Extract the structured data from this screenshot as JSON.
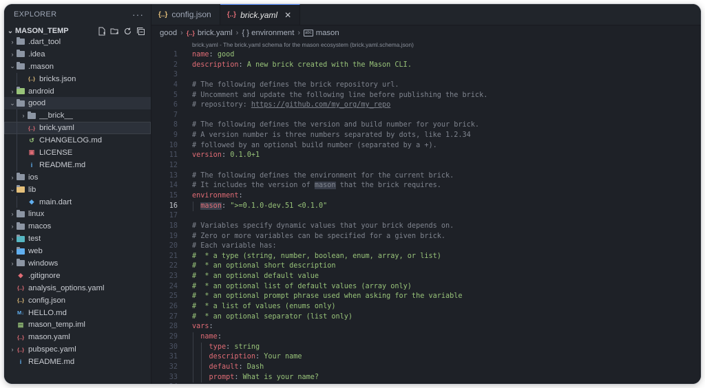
{
  "sidebar": {
    "title": "EXPLORER",
    "more": "···",
    "project": "MASON_TEMP",
    "items": [
      {
        "label": ".dart_tool",
        "depth": 0,
        "kind": "folder",
        "chevron": "›",
        "icon": "folder-icon"
      },
      {
        "label": ".idea",
        "depth": 0,
        "kind": "folder",
        "chevron": "›",
        "icon": "folder-icon"
      },
      {
        "label": ".mason",
        "depth": 0,
        "kind": "folder-open",
        "chevron": "⌄",
        "icon": "folder-icon"
      },
      {
        "label": "bricks.json",
        "depth": 1,
        "kind": "json",
        "icon": "json-icon"
      },
      {
        "label": "android",
        "depth": 0,
        "kind": "folder-android",
        "chevron": "›",
        "icon": "android-folder-icon"
      },
      {
        "label": "good",
        "depth": 0,
        "kind": "folder-open",
        "chevron": "⌄",
        "icon": "folder-icon",
        "selected": true
      },
      {
        "label": "__brick__",
        "depth": 1,
        "kind": "folder",
        "chevron": "›",
        "icon": "folder-icon"
      },
      {
        "label": "brick.yaml",
        "depth": 1,
        "kind": "yaml",
        "icon": "yaml-icon",
        "current": true
      },
      {
        "label": "CHANGELOG.md",
        "depth": 1,
        "kind": "changelog",
        "icon": "history-icon"
      },
      {
        "label": "LICENSE",
        "depth": 1,
        "kind": "license",
        "icon": "license-icon"
      },
      {
        "label": "README.md",
        "depth": 1,
        "kind": "info",
        "icon": "info-icon"
      },
      {
        "label": "ios",
        "depth": 0,
        "kind": "folder-ios",
        "chevron": "›",
        "icon": "ios-folder-icon"
      },
      {
        "label": "lib",
        "depth": 0,
        "kind": "folder-lib",
        "chevron": "⌄",
        "icon": "lib-folder-icon"
      },
      {
        "label": "main.dart",
        "depth": 1,
        "kind": "dart",
        "icon": "dart-icon"
      },
      {
        "label": "linux",
        "depth": 0,
        "kind": "folder",
        "chevron": "›",
        "icon": "folder-icon"
      },
      {
        "label": "macos",
        "depth": 0,
        "kind": "folder",
        "chevron": "›",
        "icon": "folder-icon"
      },
      {
        "label": "test",
        "depth": 0,
        "kind": "folder-test",
        "chevron": "›",
        "icon": "test-folder-icon"
      },
      {
        "label": "web",
        "depth": 0,
        "kind": "folder-web",
        "chevron": "›",
        "icon": "web-folder-icon"
      },
      {
        "label": "windows",
        "depth": 0,
        "kind": "folder",
        "chevron": "›",
        "icon": "folder-icon"
      },
      {
        "label": ".gitignore",
        "depth": 0,
        "kind": "git",
        "icon": "git-icon"
      },
      {
        "label": "analysis_options.yaml",
        "depth": 0,
        "kind": "yaml",
        "icon": "yaml-icon"
      },
      {
        "label": "config.json",
        "depth": 0,
        "kind": "json",
        "icon": "json-icon"
      },
      {
        "label": "HELLO.md",
        "depth": 0,
        "kind": "markdown",
        "icon": "markdown-icon"
      },
      {
        "label": "mason_temp.iml",
        "depth": 0,
        "kind": "iml",
        "icon": "iml-icon"
      },
      {
        "label": "mason.yaml",
        "depth": 0,
        "kind": "yaml",
        "icon": "yaml-icon"
      },
      {
        "label": "pubspec.yaml",
        "depth": 0,
        "kind": "yaml",
        "chevron": "›",
        "icon": "yaml-icon"
      },
      {
        "label": "README.md",
        "depth": 0,
        "kind": "info",
        "icon": "info-icon"
      }
    ]
  },
  "tabs": [
    {
      "label": "config.json",
      "icon": "{..}",
      "active": false
    },
    {
      "label": "brick.yaml",
      "icon": "{..}",
      "active": true,
      "close": "✕"
    }
  ],
  "breadcrumbs": [
    "good",
    "brick.yaml",
    "{ } environment",
    "mason"
  ],
  "editor": {
    "schema_hint": "brick.yaml - The brick.yaml schema for the mason ecosystem (brick.yaml.schema.json)",
    "current_line": 16,
    "lines": [
      [
        [
          "k",
          "name"
        ],
        [
          "p",
          ": "
        ],
        [
          "s",
          "good"
        ]
      ],
      [
        [
          "k",
          "description"
        ],
        [
          "p",
          ": "
        ],
        [
          "s",
          "A new brick created with the Mason CLI."
        ]
      ],
      [],
      [
        [
          "c",
          "# The following defines the brick repository url."
        ]
      ],
      [
        [
          "c",
          "# Uncomment and update the following line before publishing the brick."
        ]
      ],
      [
        [
          "c",
          "# repository: "
        ],
        [
          "u",
          "https://github.com/my_org/my_repo"
        ]
      ],
      [],
      [
        [
          "c",
          "# The following defines the version and build number for your brick."
        ]
      ],
      [
        [
          "c",
          "# A version number is three numbers separated by dots, like 1.2.34"
        ]
      ],
      [
        [
          "c",
          "# followed by an optional build number (separated by a +)."
        ]
      ],
      [
        [
          "k",
          "version"
        ],
        [
          "p",
          ": "
        ],
        [
          "s",
          "0.1.0+1"
        ]
      ],
      [],
      [
        [
          "c",
          "# The following defines the environment for the current brick."
        ]
      ],
      [
        [
          "c",
          "# It includes the version of "
        ],
        [
          "ch",
          "mason"
        ],
        [
          "c",
          " that the brick requires."
        ]
      ],
      [
        [
          "k",
          "environment"
        ],
        [
          "p",
          ":"
        ]
      ],
      [
        [
          "p",
          "  "
        ],
        [
          "kh",
          "mason"
        ],
        [
          "p",
          ": "
        ],
        [
          "s",
          "\">=0.1.0-dev.51 <0.1.0\""
        ]
      ],
      [],
      [
        [
          "c",
          "# Variables specify dynamic values that your brick depends on."
        ]
      ],
      [
        [
          "c",
          "# Zero or more variables can be specified for a given brick."
        ]
      ],
      [
        [
          "c",
          "# Each variable has:"
        ]
      ],
      [
        [
          "s",
          "#  * a type (string, number, boolean, enum, array, or list)"
        ]
      ],
      [
        [
          "s",
          "#  * an optional short description"
        ]
      ],
      [
        [
          "s",
          "#  * an optional default value"
        ]
      ],
      [
        [
          "s",
          "#  * an optional list of default values (array only)"
        ]
      ],
      [
        [
          "s",
          "#  * an optional prompt phrase used when asking for the variable"
        ]
      ],
      [
        [
          "s",
          "#  * a list of values (enums only)"
        ]
      ],
      [
        [
          "s",
          "#  * an optional separator (list only)"
        ]
      ],
      [
        [
          "k",
          "vars"
        ],
        [
          "p",
          ":"
        ]
      ],
      [
        [
          "p",
          "  "
        ],
        [
          "k",
          "name"
        ],
        [
          "p",
          ":"
        ]
      ],
      [
        [
          "p",
          "    "
        ],
        [
          "k",
          "type"
        ],
        [
          "p",
          ": "
        ],
        [
          "s",
          "string"
        ]
      ],
      [
        [
          "p",
          "    "
        ],
        [
          "k",
          "description"
        ],
        [
          "p",
          ": "
        ],
        [
          "s",
          "Your name"
        ]
      ],
      [
        [
          "p",
          "    "
        ],
        [
          "k",
          "default"
        ],
        [
          "p",
          ": "
        ],
        [
          "s",
          "Dash"
        ]
      ],
      [
        [
          "p",
          "    "
        ],
        [
          "k",
          "prompt"
        ],
        [
          "p",
          ": "
        ],
        [
          "s",
          "What is your name?"
        ]
      ],
      []
    ]
  },
  "colors": {
    "keyword": "#e06c75",
    "string": "#98c379",
    "comment": "#7f848e",
    "accent": "#528bff"
  }
}
